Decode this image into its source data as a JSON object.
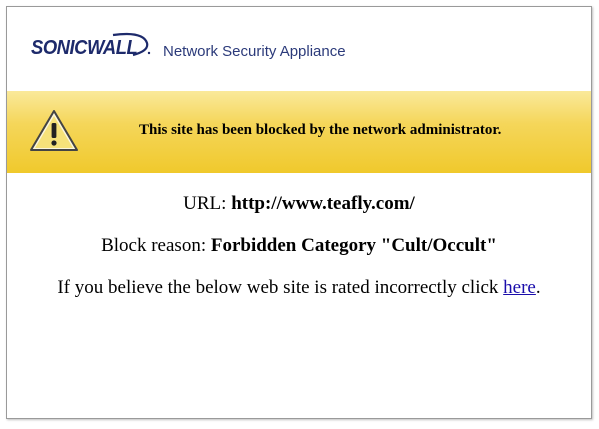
{
  "header": {
    "logo_text": "SONICWALL",
    "product_name": "Network Security Appliance"
  },
  "banner": {
    "icon": "warning-triangle-icon",
    "message": "This site has been blocked by the network administrator."
  },
  "block_info": {
    "url_label": "URL:",
    "url_value": "http://www.teafly.com/",
    "reason_label": "Block reason:",
    "reason_value": "Forbidden Category \"Cult/Occult\"",
    "rating_prefix": "If you believe the below web site is rated incorrectly click",
    "rating_link": "here",
    "rating_suffix": "."
  },
  "colors": {
    "banner_top": "#fae99a",
    "banner_bottom": "#f0c92c",
    "brand_navy": "#1d2a6b",
    "link": "#1a0dab"
  }
}
